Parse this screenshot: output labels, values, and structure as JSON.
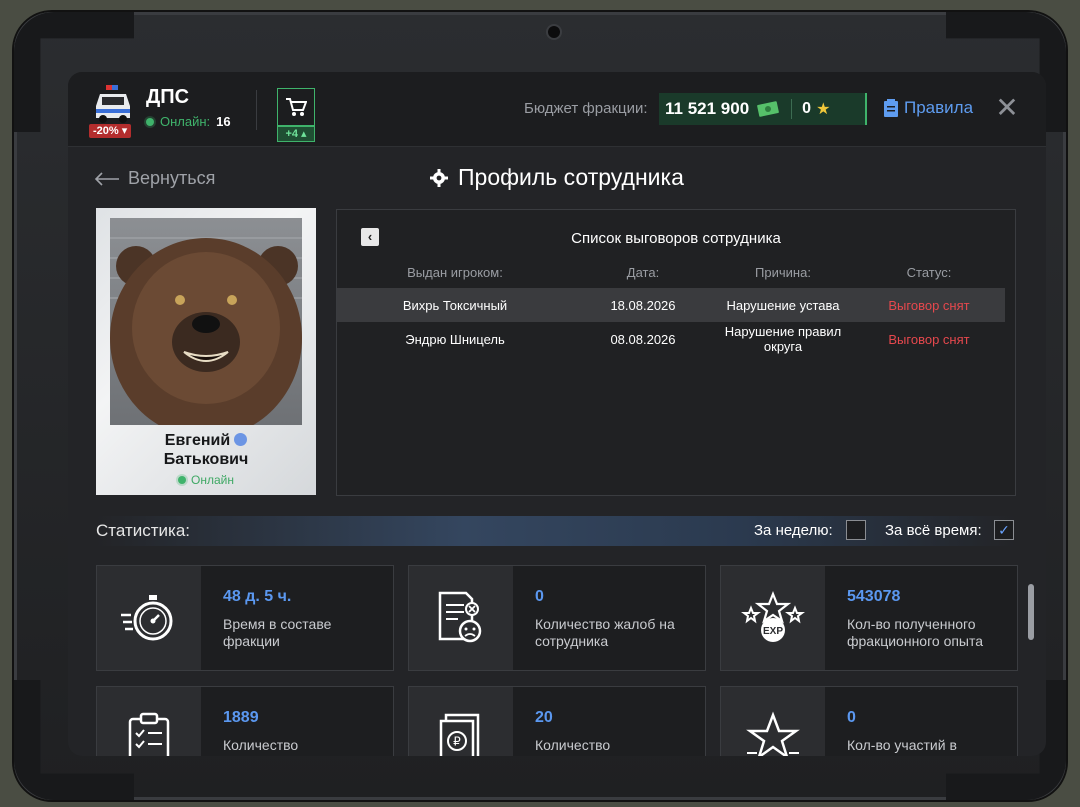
{
  "header": {
    "faction_name": "ДПС",
    "discount": "-20%",
    "online_label": "Онлайн:",
    "online_count": "16",
    "cart_badge": "+4",
    "budget_label": "Бюджет фракции:",
    "budget_value": "11 521 900",
    "stars_value": "0",
    "rules_label": "Правила",
    "close_label": "✕"
  },
  "nav": {
    "back_label": "Вернуться",
    "page_title": "Профиль сотрудника"
  },
  "profile": {
    "first_name": "Евгений",
    "last_name": "Батькович",
    "status": "Онлайн"
  },
  "reprimands": {
    "title": "Список выговоров сотрудника",
    "back_label": "‹",
    "columns": [
      "Выдан игроком:",
      "Дата:",
      "Причина:",
      "Статус:"
    ],
    "rows": [
      {
        "issuer": "Вихрь Токсичный",
        "date": "18.08.2026",
        "reason": "Нарушение устава",
        "status": "Выговор снят"
      },
      {
        "issuer": "Эндрю Шницель",
        "date": "08.08.2026",
        "reason": "Нарушение правил округа",
        "status": "Выговор снят"
      }
    ]
  },
  "stats": {
    "label": "Статистика:",
    "week_label": "За неделю:",
    "week_checked": false,
    "all_label": "За всё время:",
    "all_checked": true,
    "cards": [
      {
        "value": "48 д. 5 ч.",
        "label": "Время в составе фракции",
        "icon": "stopwatch-icon"
      },
      {
        "value": "0",
        "label": "Количество жалоб на сотрудника",
        "icon": "complaint-document-icon"
      },
      {
        "value": "543078",
        "label": "Кол-во полученного фракционного опыта",
        "icon": "exp-stars-icon"
      },
      {
        "value": "1889",
        "label": "Количество",
        "icon": "clipboard-checklist-icon"
      },
      {
        "value": "20",
        "label": "Количество",
        "icon": "ruble-document-icon"
      },
      {
        "value": "0",
        "label": "Кол-во участий в",
        "icon": "star-icon"
      }
    ]
  },
  "colors": {
    "accent_blue": "#5b98f0",
    "online_green": "#3fb36b",
    "status_red": "#e5484d"
  }
}
